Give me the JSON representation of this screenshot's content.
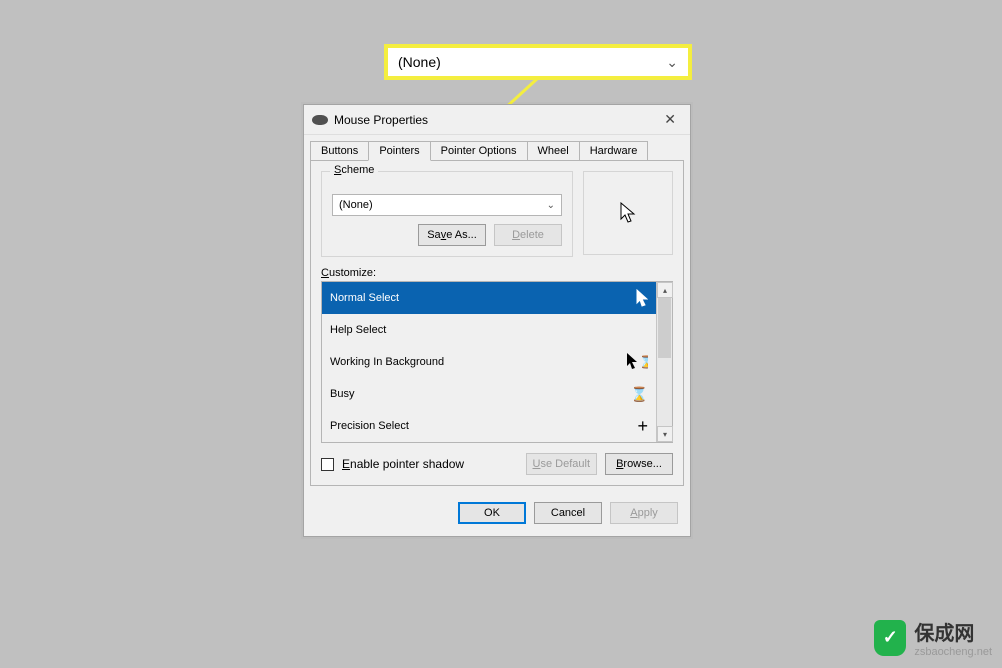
{
  "callouts": {
    "top_value": "(None)",
    "shadow_label": "Enable pointer shadow"
  },
  "dialog": {
    "title": "Mouse Properties",
    "tabs": [
      "Buttons",
      "Pointers",
      "Pointer Options",
      "Wheel",
      "Hardware"
    ],
    "active_tab_index": 1,
    "scheme": {
      "legend": "Scheme",
      "selected": "(None)",
      "save_as_label": "Save As...",
      "delete_label": "Delete"
    },
    "customize_label": "Customize:",
    "cursors": [
      {
        "label": "Normal Select",
        "icon": "arrow",
        "selected": true
      },
      {
        "label": "Help Select",
        "icon": "arrow",
        "selected": false
      },
      {
        "label": "Working In Background",
        "icon": "arrow-hourglass",
        "selected": false
      },
      {
        "label": "Busy",
        "icon": "hourglass",
        "selected": false
      },
      {
        "label": "Precision Select",
        "icon": "crosshair",
        "selected": false
      }
    ],
    "enable_shadow_label": "Enable pointer shadow",
    "enable_shadow_checked": false,
    "use_default_label": "Use Default",
    "browse_label": "Browse...",
    "ok_label": "OK",
    "cancel_label": "Cancel",
    "apply_label": "Apply"
  },
  "watermark": {
    "title": "保成网",
    "url": "zsbaocheng.net"
  }
}
